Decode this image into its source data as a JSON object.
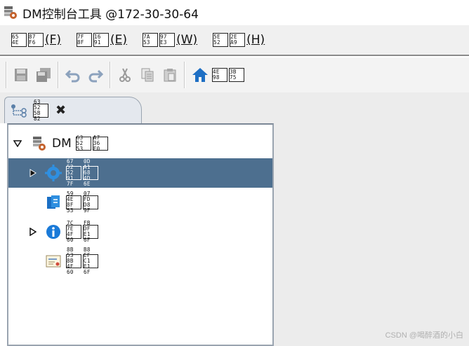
{
  "window": {
    "title": "DM控制台工具 @172-30-30-64"
  },
  "menubar": [
    {
      "hex": [
        "65 4E",
        "87 F6"
      ],
      "mnemonic": "(F)"
    },
    {
      "hex": [
        "7F 8F",
        "16 91"
      ],
      "mnemonic": "(E)"
    },
    {
      "hex": [
        "7A 53",
        "97 E3"
      ],
      "mnemonic": "(W)"
    },
    {
      "hex": [
        "5E 52",
        "2E A9"
      ],
      "mnemonic": "(H)"
    }
  ],
  "toolbar": {
    "home_hex": [
      "4E 98",
      "3B 75"
    ]
  },
  "tab": {
    "hex": [
      "63 52 5B 82",
      "A7 36 FC 2A"
    ]
  },
  "tree": {
    "root": {
      "prefix": "DM",
      "hex": [
        "63 52 53",
        "A7 36 F0"
      ]
    },
    "nodes": [
      {
        "hex": [
          "67 52 52 91 7F",
          "0D A1 68 4D 6E"
        ]
      },
      {
        "hex": [
          "59 4E 8F 53",
          "07 FD D8 9F"
        ]
      },
      {
        "hex": [
          "7C 7E 4F 60",
          "FB DF E1 6F"
        ]
      },
      {
        "hex": [
          "8B 53 8B 4F 60",
          "B8 EF C1 E1 6F"
        ]
      }
    ]
  },
  "watermark": "CSDN @喝醉酒的小白",
  "colors": {
    "selection": "#4d6f8f",
    "home_icon": "#1e6fc4",
    "info_icon": "#1a7ad8"
  }
}
